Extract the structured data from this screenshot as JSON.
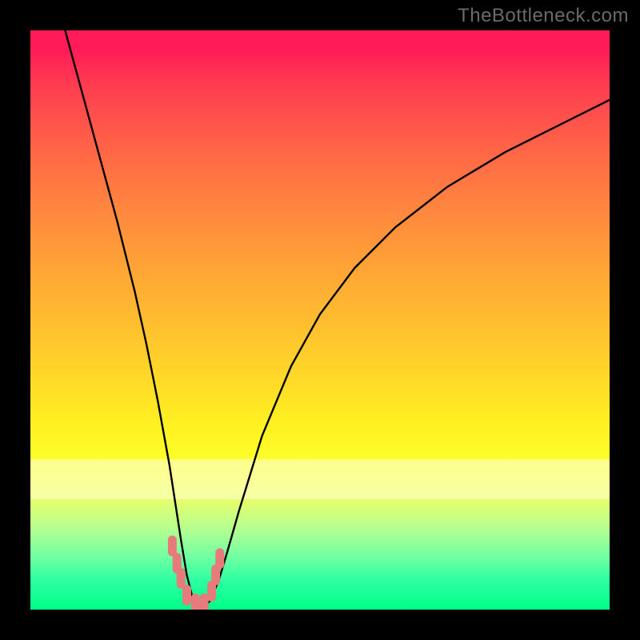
{
  "watermark": "TheBottleneck.com",
  "chart_data": {
    "type": "line",
    "title": "",
    "xlabel": "",
    "ylabel": "",
    "xlim": [
      0,
      100
    ],
    "ylim": [
      0,
      100
    ],
    "series": [
      {
        "name": "bottleneck-curve",
        "x": [
          6,
          9,
          12,
          15,
          18,
          20,
          22,
          24,
          26,
          27,
          28,
          29,
          30,
          31,
          32.5,
          34,
          36,
          40,
          45,
          50,
          56,
          63,
          72,
          82,
          92,
          100
        ],
        "values": [
          100,
          89,
          78,
          67,
          55,
          46,
          36,
          25,
          12,
          6,
          2,
          0.5,
          0.5,
          1.5,
          5,
          10,
          17,
          30,
          42,
          51,
          59,
          66,
          73,
          79,
          84,
          88
        ]
      },
      {
        "name": "highlight-markers",
        "x": [
          24.5,
          25.3,
          26.0,
          27.0,
          28.5,
          30.0,
          31.3,
          32.0,
          32.7
        ],
        "values": [
          11.0,
          8.0,
          5.4,
          2.5,
          1.0,
          1.0,
          3.2,
          6.0,
          8.8
        ]
      }
    ],
    "colors": {
      "curve": "#000000",
      "marker": "#e77a7a",
      "gradient_top": "#ff1a58",
      "gradient_bottom": "#00ff88"
    }
  }
}
